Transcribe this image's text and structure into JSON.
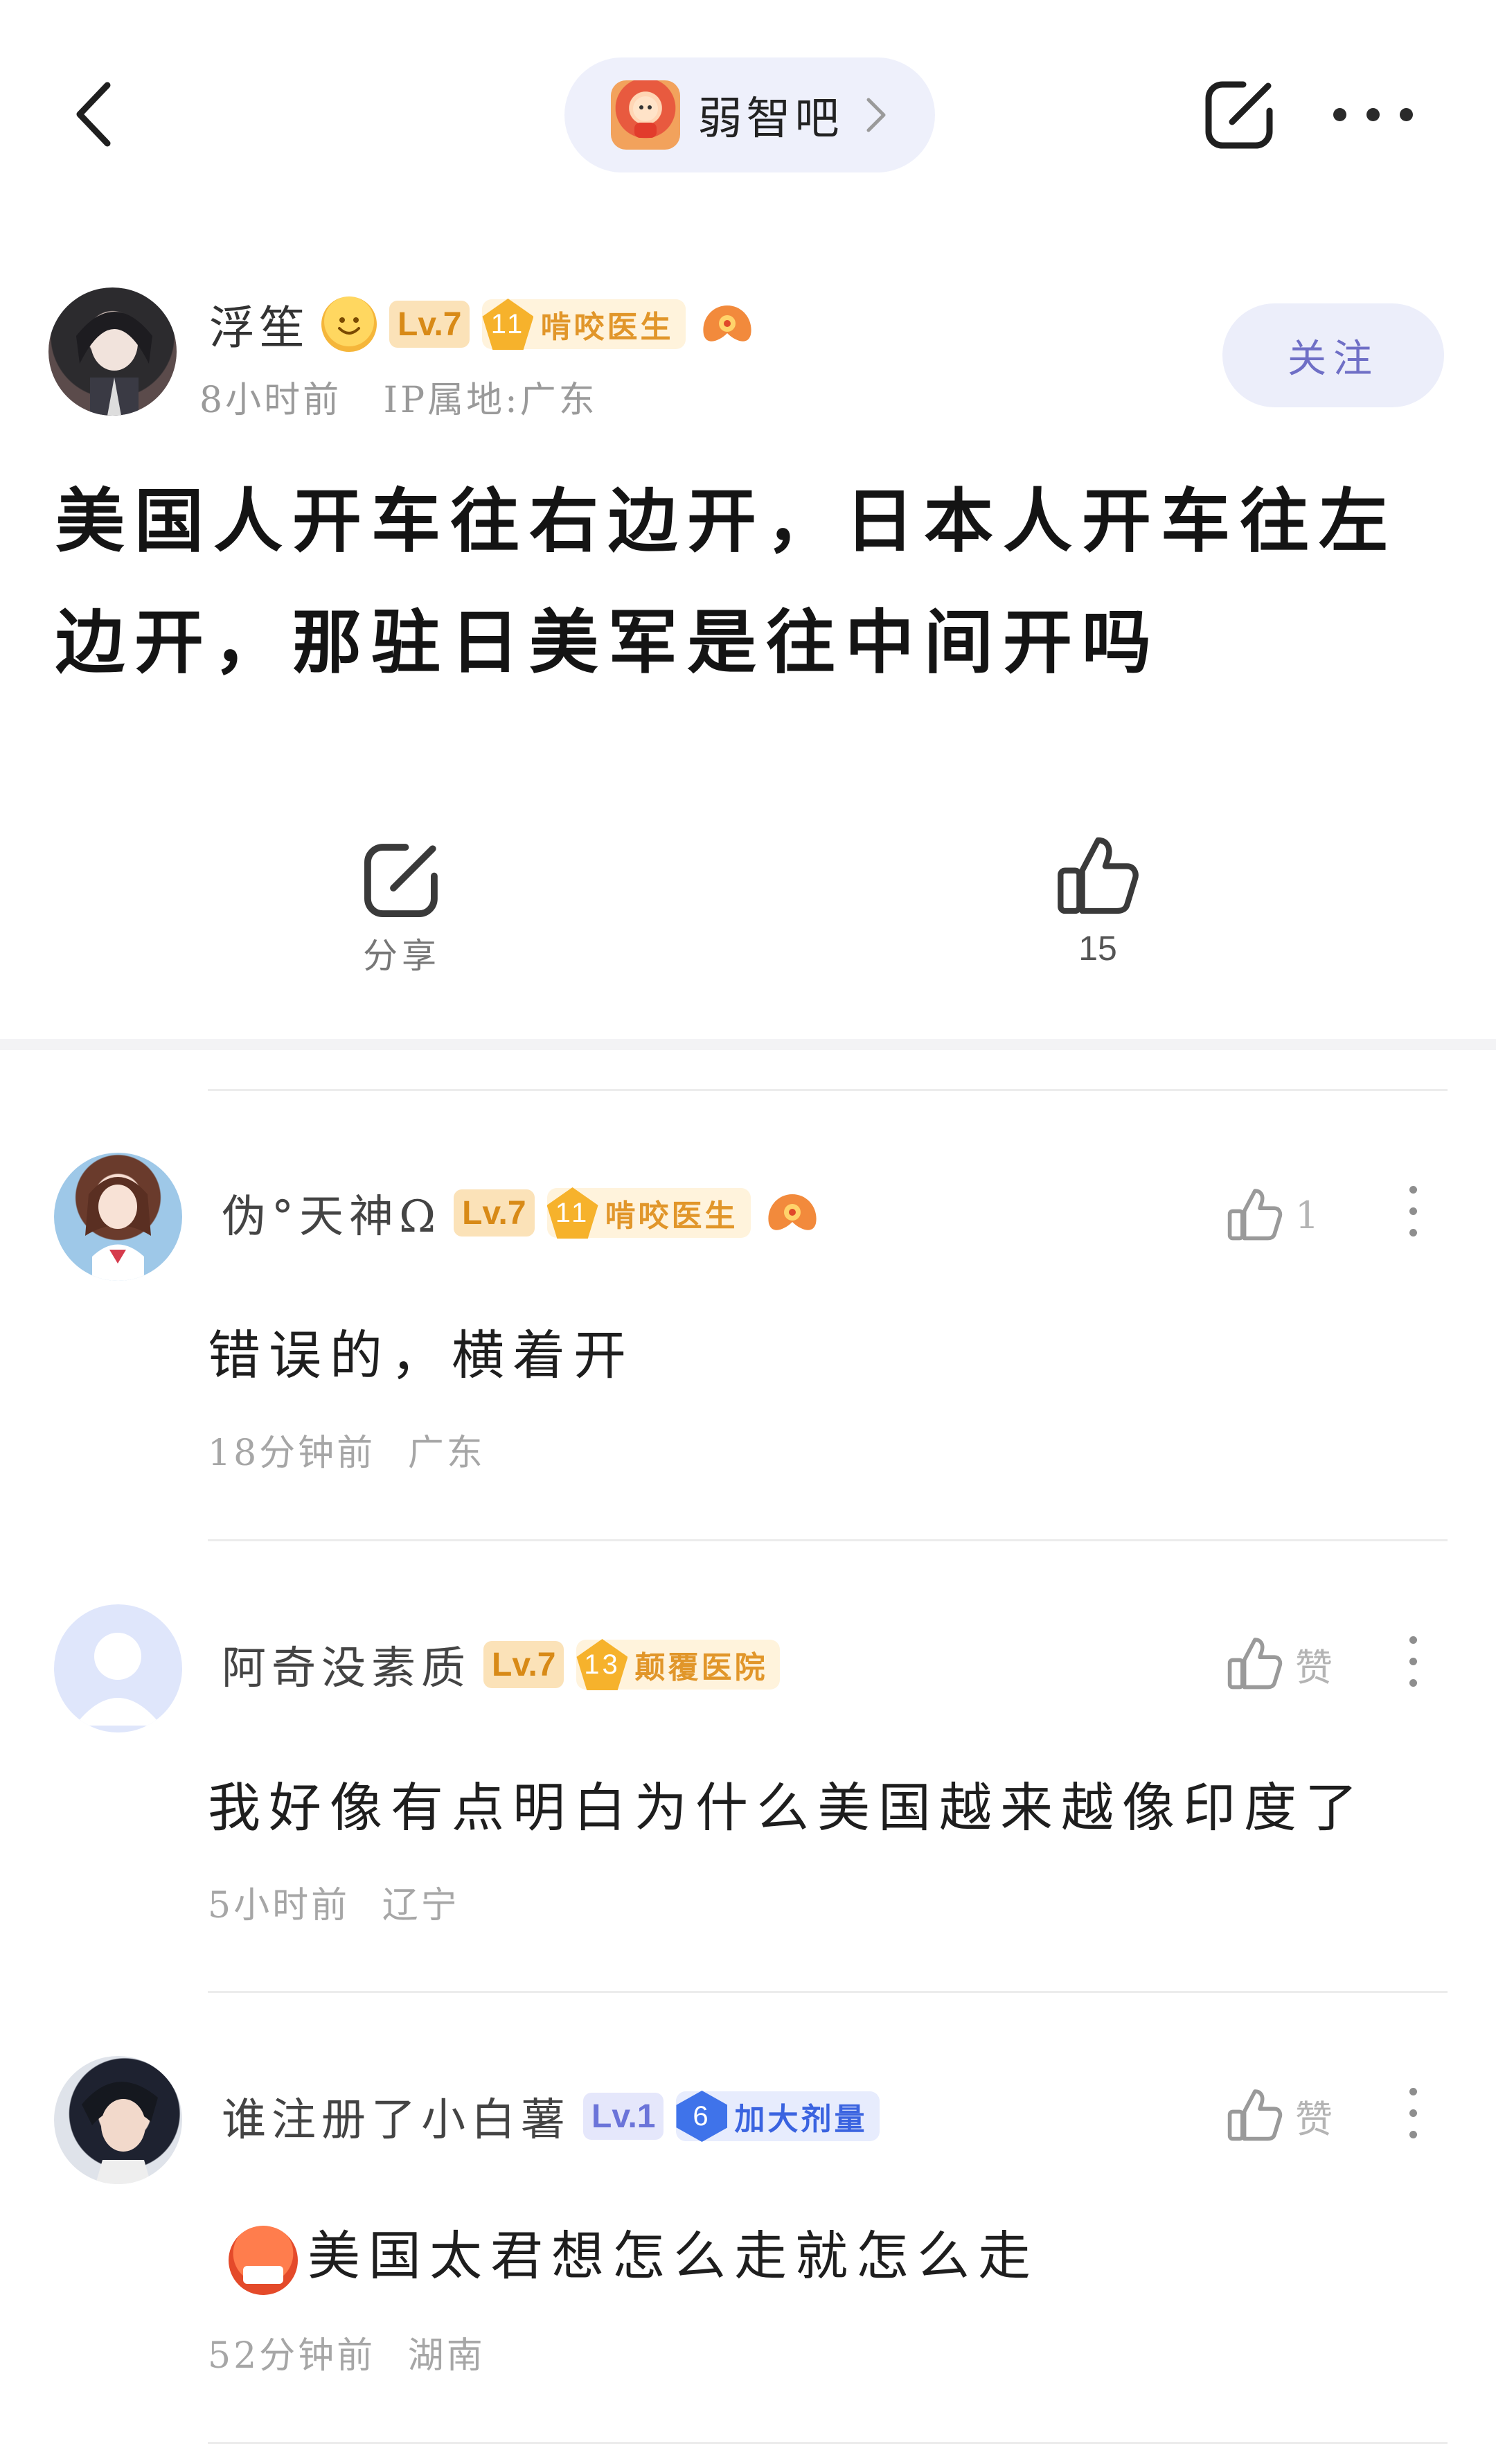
{
  "header": {
    "forum_name": "弱智吧",
    "icons": {
      "back": "chevron-left-icon",
      "share": "share-icon",
      "more": "more-icon",
      "forum_chevron": "chevron-right-icon"
    }
  },
  "post": {
    "author": {
      "name": "浮笙",
      "level": "Lv.7",
      "badge_level": "11",
      "badge_title": "啃咬医生",
      "time": "8小时前",
      "ip_location": "IP属地:广东"
    },
    "follow_label": "关注",
    "title": "美国人开车往右边开，日本人开车往左边开，那驻日美军是往中间开吗",
    "share_label": "分享",
    "like_count": "15"
  },
  "comments": [
    {
      "user": "伪°天神Ω",
      "level": "Lv.7",
      "badge_level": "11",
      "badge_title": "啃咬医生",
      "like_label": "1",
      "text": "错误的，横着开",
      "time": "18分钟前",
      "location": "广东"
    },
    {
      "user": "阿奇没素质",
      "level": "Lv.7",
      "badge_level": "13",
      "badge_title": "颠覆医院",
      "like_label": "赞",
      "text": "我好像有点明白为什么美国越来越像印度了",
      "time": "5小时前",
      "location": "辽宁"
    },
    {
      "user": "谁注册了小白薯",
      "level": "Lv.1",
      "badge_level": "6",
      "badge_title": "加大剂量",
      "like_label": "赞",
      "text": "美国太君想怎么走就怎么走",
      "time": "52分钟前",
      "location": "湖南"
    }
  ],
  "colors": {
    "accent": "#6f6fc6",
    "level_bg": "#fbe2b8",
    "level_text": "#d88a17",
    "badge_gold": "#f6b22c",
    "badge_blue": "#3f73ea",
    "meta_gray": "#a6a6a6"
  }
}
